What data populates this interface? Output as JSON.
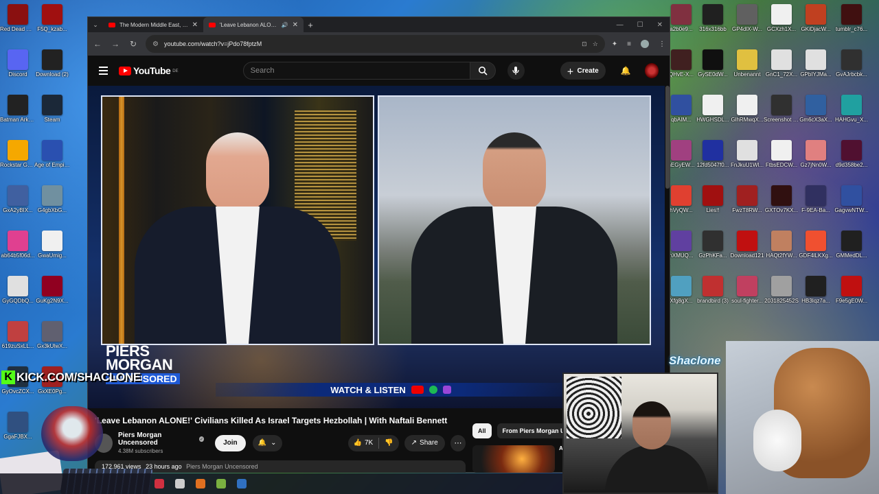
{
  "desktop": {
    "left_icons": [
      {
        "label": "Red Dead Redempti...",
        "color": "#8a1010"
      },
      {
        "label": "Discord",
        "color": "#5865f2"
      },
      {
        "label": "Batman Arkham As...",
        "color": "#222222"
      },
      {
        "label": "Rockstar Games ...",
        "color": "#f5a800"
      },
      {
        "label": "GxA2yBIX...",
        "color": "#4060a0"
      },
      {
        "label": "ab64b5f06d...",
        "color": "#e04090"
      },
      {
        "label": "GyGQDbQ...",
        "color": "#e0e0e0"
      },
      {
        "label": "619zuSxLL...",
        "color": "#c04040"
      },
      {
        "label": "GyOvcZCX...",
        "color": "#203040"
      },
      {
        "label": "GgaFJBX...",
        "color": "#305080"
      }
    ],
    "left_icons_2": [
      {
        "label": "F5Q_kzab...",
        "color": "#a01010"
      },
      {
        "label": "Download (2)",
        "color": "#222222"
      },
      {
        "label": "Steam",
        "color": "#1b2838"
      },
      {
        "label": "Age of Empires...",
        "color": "#2a50b0"
      },
      {
        "label": "G4gbXbG...",
        "color": "#7090a0"
      },
      {
        "label": "GwaUmig...",
        "color": "#f0f0f0"
      },
      {
        "label": "GuKg2N9X...",
        "color": "#900020"
      },
      {
        "label": "Gx3kUlwX...",
        "color": "#606070"
      },
      {
        "label": "GxXE0Pg...",
        "color": "#a02020"
      }
    ],
    "right_icons_1": [
      {
        "label": "a2b0e9...",
        "color": "#803040"
      },
      {
        "label": "QHvE-X...",
        "color": "#402020"
      },
      {
        "label": "qbAIM...",
        "color": "#3050a0"
      },
      {
        "label": "hEGyEW...",
        "color": "#a04080"
      },
      {
        "label": "hVyQW...",
        "color": "#e04030"
      },
      {
        "label": "nXMUQ...",
        "color": "#6040a0"
      },
      {
        "label": "Xfg8gX...",
        "color": "#50a0c0"
      }
    ],
    "right_icons_2": [
      {
        "label": "316x316bb",
        "color": "#202020"
      },
      {
        "label": "GySE0dW...",
        "color": "#101010"
      },
      {
        "label": "HWGHSDL...",
        "color": "#f0f0f0"
      },
      {
        "label": "12fd5047f0...",
        "color": "#2030a0"
      },
      {
        "label": "Lies!!",
        "color": "#a01010"
      },
      {
        "label": "GzPhKFa...",
        "color": "#303030"
      },
      {
        "label": "brandbird (3)",
        "color": "#c03030"
      }
    ],
    "right_icons_3": [
      {
        "label": "GP4dlX-W...",
        "color": "#606060"
      },
      {
        "label": "Unbenannt",
        "color": "#e0c040"
      },
      {
        "label": "GlhRMwqX...",
        "color": "#f0f0f0"
      },
      {
        "label": "FnJkuU1Wl...",
        "color": "#e0e0e0"
      },
      {
        "label": "FwzT8RW...",
        "color": "#a02020"
      },
      {
        "label": "Download121",
        "color": "#c01010"
      },
      {
        "label": "soul-fighter...",
        "color": "#c04060"
      }
    ],
    "right_icons_4": [
      {
        "label": "GCXzh1X...",
        "color": "#f0f0f0"
      },
      {
        "label": "GnC1_72X...",
        "color": "#e0e0e0"
      },
      {
        "label": "Screenshot 2023-06-...",
        "color": "#303030"
      },
      {
        "label": "FtbsEDCW...",
        "color": "#f0f0f0"
      },
      {
        "label": "GXTOv7KX...",
        "color": "#301010"
      },
      {
        "label": "HAQt2fYW...",
        "color": "#c08060"
      },
      {
        "label": "2031825452S",
        "color": "#a0a0a0"
      }
    ],
    "right_icons_5": [
      {
        "label": "GKiDjacW...",
        "color": "#c04020"
      },
      {
        "label": "GPbIYJMa...",
        "color": "#e0e0e0"
      },
      {
        "label": "Gm6cX3aX...",
        "color": "#3060a0"
      },
      {
        "label": "Gz7jNn0W...",
        "color": "#e08080"
      },
      {
        "label": "F-9EA-Ba...",
        "color": "#303060"
      },
      {
        "label": "GDF4lLKXg...",
        "color": "#f05030"
      },
      {
        "label": "HB3Iqz7a...",
        "color": "#202020"
      }
    ],
    "right_icons_6": [
      {
        "label": "tumblr_c76...",
        "color": "#401010"
      },
      {
        "label": "GvAJrbcbk...",
        "color": "#303030"
      },
      {
        "label": "HAHGvu_X...",
        "color": "#20a0a0"
      },
      {
        "label": "d9d358be2...",
        "color": "#501030"
      },
      {
        "label": "GagvwNTW...",
        "color": "#3050a0"
      },
      {
        "label": "GMMedDL...",
        "color": "#202020"
      },
      {
        "label": "F9e5gE0W...",
        "color": "#c01010"
      }
    ]
  },
  "browser": {
    "tabs": [
      {
        "title": "The Modern Middle East, Expla",
        "active": false
      },
      {
        "title": "'Leave Lebanon ALONE!' Ci",
        "active": true
      }
    ],
    "url": "youtube.com/watch?v=jPdo78fptzM"
  },
  "youtube": {
    "logo": "YouTube",
    "region": "DE",
    "search_placeholder": "Search",
    "create_label": "Create",
    "video": {
      "title": "'Leave Lebanon ALONE!' Civilians Killed As Israel Targets Hezbollah | With Naftali Bennett",
      "overlay_brand_1": "PIERS",
      "overlay_brand_2": "MORGAN",
      "overlay_brand_3": "UNCENSORED",
      "watch_listen": "WATCH & LISTEN"
    },
    "channel": {
      "name": "Piers Morgan Uncensored",
      "subscribers": "4.38M subscribers",
      "join_label": "Join"
    },
    "actions": {
      "likes": "7K",
      "share_label": "Share"
    },
    "description": {
      "views": "172,961 views",
      "age": "23 hours ago",
      "tag": "Piers Morgan Uncensored"
    },
    "chips": [
      "All",
      "From Piers Morgan U"
    ],
    "rec_snippet": "An Kn"
  },
  "overlay": {
    "kick_text": "KICK.COM/SHACLONE",
    "streamer_name": "Shaclone"
  }
}
